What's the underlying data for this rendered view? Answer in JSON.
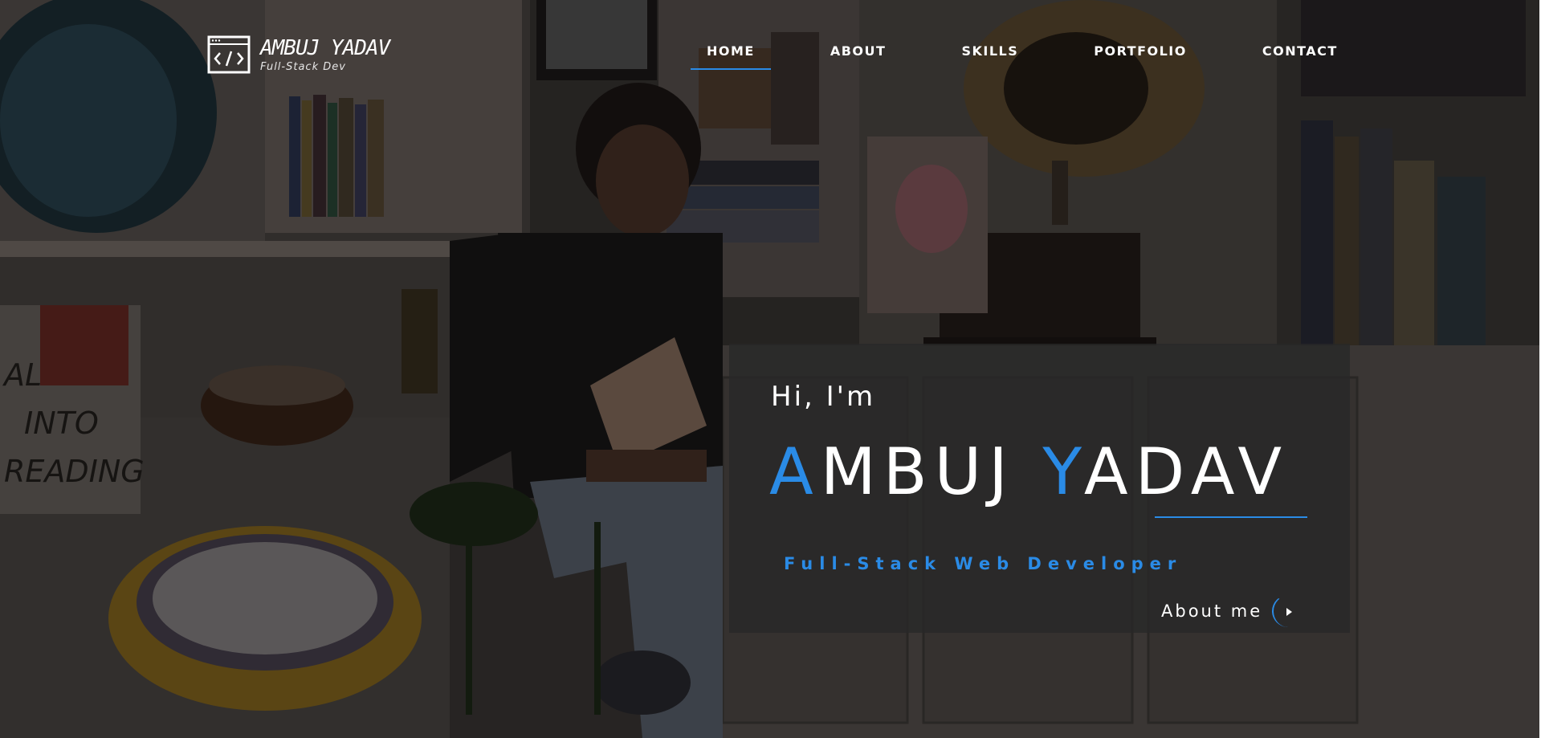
{
  "brand": {
    "name": "AMBUJ YADAV",
    "tagline": "Full-Stack Dev",
    "icon": "code-window-icon"
  },
  "nav": {
    "items": [
      {
        "label": "HOME",
        "active": true
      },
      {
        "label": "ABOUT",
        "active": false
      },
      {
        "label": "SKILLS",
        "active": false
      },
      {
        "label": "PORTFOLIO",
        "active": false
      },
      {
        "label": "CONTACT",
        "active": false
      }
    ]
  },
  "hero": {
    "greeting": "Hi, I'm",
    "name_first_initial": "A",
    "name_first_rest": "MBUJ ",
    "name_last_initial": "Y",
    "name_last_rest": "ADAV",
    "role": "Full-Stack Web Developer",
    "about_button": "About me",
    "about_icon": "play-arrow-icon",
    "background_sign": [
      "ALL",
      "INTO",
      "READING"
    ]
  },
  "colors": {
    "accent": "#2a8be6",
    "overlay": "#282828",
    "text": "#ffffff"
  }
}
